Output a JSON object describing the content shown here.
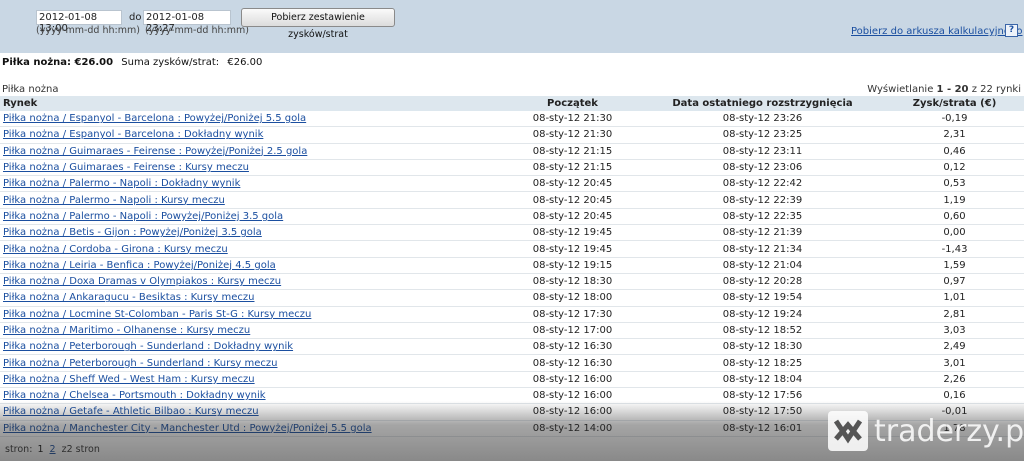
{
  "filter": {
    "from_value": "2012-01-08 13:00",
    "to_label": "do",
    "to_value": "2012-01-08 23:27",
    "from_hint": "(yyyy-mm-dd hh:mm)",
    "to_hint": "(yyyy-mm-dd hh:mm)",
    "button_label": "Pobierz zestawienie zysków/strat",
    "spreadsheet_link": "Pobierz do arkusza kalkulacyjnego",
    "help_label": "?"
  },
  "summary": {
    "sport_total": "Piłka nożna: €26.00",
    "sum_label": "Suma zysków/strat:",
    "sum_value": "€26.00"
  },
  "table": {
    "section_label": "Piłka nożna",
    "showing_prefix": "Wyświetlanie",
    "showing_range": "1 - 20",
    "showing_suffix": "z 22 rynki",
    "headers": [
      "Rynek",
      "Początek",
      "Data ostatniego rozstrzygnięcia",
      "Zysk/strata (€)"
    ],
    "rows": [
      {
        "market": "Piłka nożna / Espanyol - Barcelona : Powyżej/Poniżej 5.5 gola",
        "start": "08-sty-12 21:30",
        "settled": "08-sty-12 23:26",
        "pl": "-0,19"
      },
      {
        "market": "Piłka nożna / Espanyol - Barcelona : Dokładny wynik",
        "start": "08-sty-12 21:30",
        "settled": "08-sty-12 23:25",
        "pl": "2,31"
      },
      {
        "market": "Piłka nożna / Guimaraes - Feirense : Powyżej/Poniżej 2.5 gola",
        "start": "08-sty-12 21:15",
        "settled": "08-sty-12 23:11",
        "pl": "0,46"
      },
      {
        "market": "Piłka nożna / Guimaraes - Feirense : Kursy meczu",
        "start": "08-sty-12 21:15",
        "settled": "08-sty-12 23:06",
        "pl": "0,12"
      },
      {
        "market": "Piłka nożna / Palermo - Napoli : Dokładny wynik",
        "start": "08-sty-12 20:45",
        "settled": "08-sty-12 22:42",
        "pl": "0,53"
      },
      {
        "market": "Piłka nożna / Palermo - Napoli : Kursy meczu",
        "start": "08-sty-12 20:45",
        "settled": "08-sty-12 22:39",
        "pl": "1,19"
      },
      {
        "market": "Piłka nożna / Palermo - Napoli : Powyżej/Poniżej 3.5 gola",
        "start": "08-sty-12 20:45",
        "settled": "08-sty-12 22:35",
        "pl": "0,60"
      },
      {
        "market": "Piłka nożna / Betis - Gijon : Powyżej/Poniżej 3.5 gola",
        "start": "08-sty-12 19:45",
        "settled": "08-sty-12 21:39",
        "pl": "0,00"
      },
      {
        "market": "Piłka nożna / Cordoba - Girona : Kursy meczu",
        "start": "08-sty-12 19:45",
        "settled": "08-sty-12 21:34",
        "pl": "-1,43"
      },
      {
        "market": "Piłka nożna / Leiria - Benfica : Powyżej/Poniżej 4.5 gola",
        "start": "08-sty-12 19:15",
        "settled": "08-sty-12 21:04",
        "pl": "1,59"
      },
      {
        "market": "Piłka nożna / Doxa Dramas v Olympiakos : Kursy meczu",
        "start": "08-sty-12 18:30",
        "settled": "08-sty-12 20:28",
        "pl": "0,97"
      },
      {
        "market": "Piłka nożna / Ankaragucu - Besiktas : Kursy meczu",
        "start": "08-sty-12 18:00",
        "settled": "08-sty-12 19:54",
        "pl": "1,01"
      },
      {
        "market": "Piłka nożna / Locmine St-Colomban - Paris St-G : Kursy meczu",
        "start": "08-sty-12 17:30",
        "settled": "08-sty-12 19:24",
        "pl": "2,81"
      },
      {
        "market": "Piłka nożna / Maritimo - Olhanense : Kursy meczu",
        "start": "08-sty-12 17:00",
        "settled": "08-sty-12 18:52",
        "pl": "3,03"
      },
      {
        "market": "Piłka nożna / Peterborough - Sunderland : Dokładny wynik",
        "start": "08-sty-12 16:30",
        "settled": "08-sty-12 18:30",
        "pl": "2,49"
      },
      {
        "market": "Piłka nożna / Peterborough - Sunderland : Kursy meczu",
        "start": "08-sty-12 16:30",
        "settled": "08-sty-12 18:25",
        "pl": "3,01"
      },
      {
        "market": "Piłka nożna / Sheff Wed - West Ham : Kursy meczu",
        "start": "08-sty-12 16:00",
        "settled": "08-sty-12 18:04",
        "pl": "2,26"
      },
      {
        "market": "Piłka nożna / Chelsea - Portsmouth : Dokładny wynik",
        "start": "08-sty-12 16:00",
        "settled": "08-sty-12 17:56",
        "pl": "0,16"
      },
      {
        "market": "Piłka nożna / Getafe - Athletic Bilbao : Kursy meczu",
        "start": "08-sty-12 16:00",
        "settled": "08-sty-12 17:50",
        "pl": "-0,01"
      },
      {
        "market": "Piłka nożna / Manchester City - Manchester Utd : Powyżej/Poniżej 5.5 gola",
        "start": "08-sty-12 14:00",
        "settled": "08-sty-12 16:01",
        "pl": "1,78"
      }
    ]
  },
  "pager": {
    "prefix": "stron:",
    "pages": [
      "1",
      "2"
    ],
    "suffix": "z2 stron"
  },
  "watermark": {
    "text": "traderzy.pl"
  }
}
